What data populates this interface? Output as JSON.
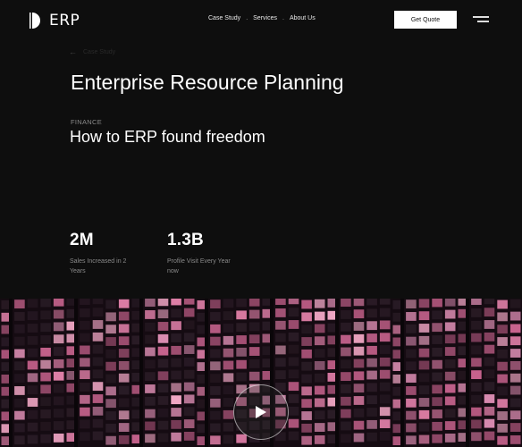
{
  "nav": {
    "logo_text": "ERP",
    "menu": [
      "Case Study",
      "Services",
      "About Us"
    ],
    "cta_label": "Get Quote"
  },
  "back": {
    "label": "Case Study"
  },
  "hero": {
    "title": "Enterprise Resource Planning",
    "category": "FINANCE",
    "subtitle": "How to ERP found freedom"
  },
  "stats": [
    {
      "value": "2M",
      "label": "Sales Increased in 2 Years"
    },
    {
      "value": "1.3B",
      "label": "Profile Visit Every Year now"
    }
  ],
  "colors": {
    "background": "#0e0e0e",
    "text": "#ffffff",
    "muted": "#8a8a8a",
    "accent_pink": "#e07fa8"
  },
  "icons": [
    "logo-half-circle-icon",
    "hamburger-icon",
    "arrow-left-icon",
    "play-icon"
  ]
}
